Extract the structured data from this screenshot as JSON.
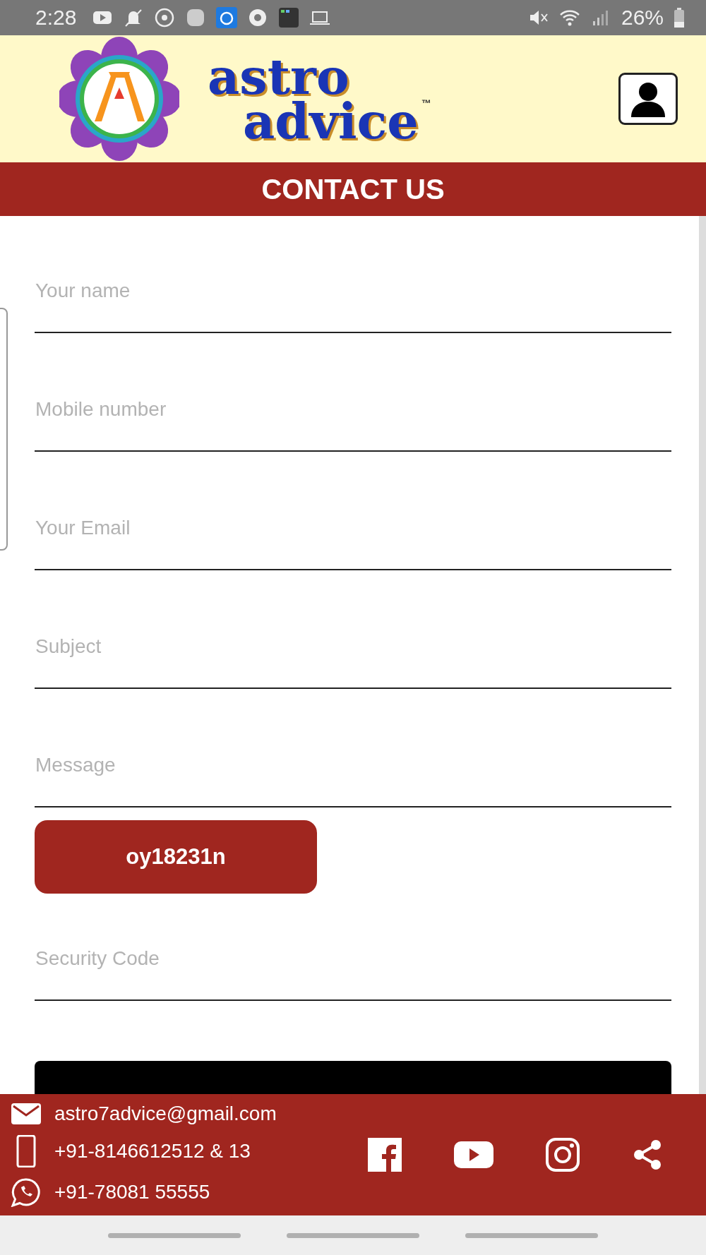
{
  "status_bar": {
    "time": "2:28",
    "battery": "26%"
  },
  "header": {
    "logo_line_1": "astro",
    "logo_line_2": "advice",
    "trademark": "™"
  },
  "title": "CONTACT US",
  "form": {
    "fields": [
      {
        "placeholder": "Your name"
      },
      {
        "placeholder": "Mobile number"
      },
      {
        "placeholder": "Your Email"
      },
      {
        "placeholder": "Subject"
      },
      {
        "placeholder": "Message"
      }
    ],
    "captcha": "oy18231n",
    "security_field": {
      "placeholder": "Security Code"
    }
  },
  "footer": {
    "contacts": [
      {
        "kind": "email",
        "text": "astro7advice@gmail.com"
      },
      {
        "kind": "phone",
        "text": "+91-8146612512 & 13"
      },
      {
        "kind": "whatsapp",
        "text": "+91-78081 55555"
      }
    ],
    "social": [
      {
        "kind": "facebook"
      },
      {
        "kind": "youtube"
      },
      {
        "kind": "instagram"
      },
      {
        "kind": "share"
      }
    ]
  }
}
